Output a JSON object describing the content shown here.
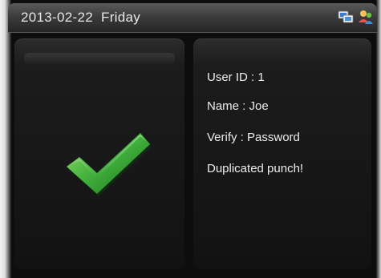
{
  "status_bar": {
    "date_text": "2013-02-22  Friday",
    "icons": [
      "network-icon",
      "user-icon"
    ]
  },
  "result": {
    "icon": "checkmark-icon",
    "color": "#3fae3a"
  },
  "user_info": {
    "user_id": "User ID : 1",
    "name": "Name : Joe",
    "verify": "Verify : Password",
    "message": "Duplicated punch!"
  }
}
